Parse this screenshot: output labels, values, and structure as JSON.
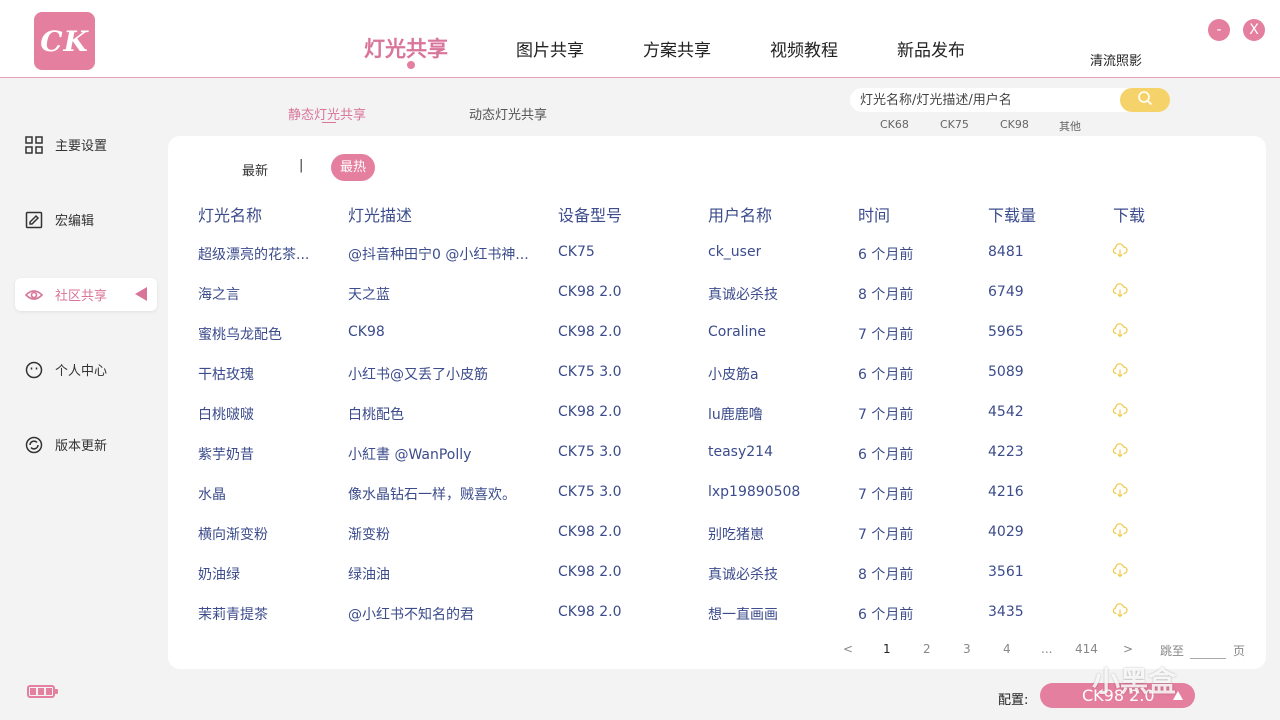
{
  "app": {
    "logo_text": "CK",
    "username": "清流照影",
    "accent": "#e57f9f",
    "link_color": "#3c4c8c"
  },
  "nav": [
    "灯光共享",
    "图片共享",
    "方案共享",
    "视频教程",
    "新品发布"
  ],
  "window": {
    "minimize": "-",
    "close": "X"
  },
  "sidebar": [
    {
      "label": "主要设置",
      "icon": "grid-icon"
    },
    {
      "label": "宏编辑",
      "icon": "edit-icon"
    },
    {
      "label": "社区共享",
      "icon": "eye-icon"
    },
    {
      "label": "个人中心",
      "icon": "smiley-icon"
    },
    {
      "label": "版本更新",
      "icon": "refresh-icon"
    }
  ],
  "subtabs": [
    "静态灯光共享",
    "动态灯光共享"
  ],
  "search": {
    "placeholder": "灯光名称/灯光描述/用户名"
  },
  "filters": [
    "CK68",
    "CK75",
    "CK98",
    "其他"
  ],
  "sort": {
    "new": "最新",
    "sep": "|",
    "hot": "最热"
  },
  "table": {
    "headers": [
      "灯光名称",
      "灯光描述",
      "设备型号",
      "用户名称",
      "时间",
      "下载量",
      "下载"
    ],
    "rows": [
      [
        "超级漂亮的花茶...",
        "@抖音种田宁0 @小红书神...",
        "CK75",
        "ck_user",
        "6 个月前",
        "8481"
      ],
      [
        "海之言",
        "天之蓝",
        "CK98 2.0",
        "真诚必杀技",
        "8 个月前",
        "6749"
      ],
      [
        "蜜桃乌龙配色",
        "CK98",
        "CK98 2.0",
        "Coraline",
        "7 个月前",
        "5965"
      ],
      [
        "干枯玫瑰",
        "小红书@又丢了小皮筋",
        "CK75 3.0",
        "小皮筋a",
        "6 个月前",
        "5089"
      ],
      [
        "白桃啵啵",
        "白桃配色",
        "CK98 2.0",
        "lu鹿鹿噜",
        "7 个月前",
        "4542"
      ],
      [
        "紫芋奶昔",
        "小紅書 @WanPolly",
        "CK75 3.0",
        "teasy214",
        "6 个月前",
        "4223"
      ],
      [
        "水晶",
        "像水晶钻石一样，贼喜欢。",
        "CK75 3.0",
        "lxp19890508",
        "7 个月前",
        "4216"
      ],
      [
        "横向渐变粉",
        "渐变粉",
        "CK98 2.0",
        "别吃猪崽",
        "7 个月前",
        "4029"
      ],
      [
        "奶油绿",
        "绿油油",
        "CK98 2.0",
        "真诚必杀技",
        "8 个月前",
        "3561"
      ],
      [
        "茉莉青提茶",
        "@小红书不知名的君",
        "CK98 2.0",
        "想一直画画",
        "6 个月前",
        "3435"
      ]
    ]
  },
  "pagination": {
    "prev": "<",
    "pages": [
      "1",
      "2",
      "3",
      "4",
      "...",
      "414"
    ],
    "next": ">",
    "jump_label": "跳至",
    "page_label": "页"
  },
  "footer": {
    "config_label": "配置:",
    "config_value": "CK98 2.0",
    "watermark": "小黑盒"
  }
}
